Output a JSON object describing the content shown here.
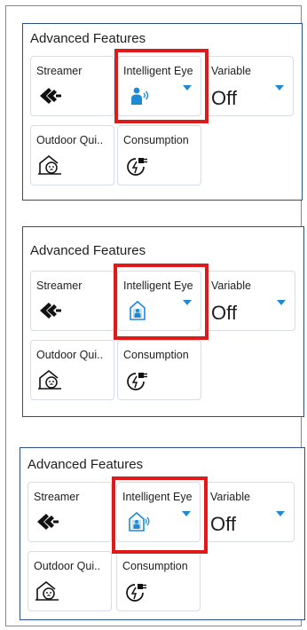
{
  "panels": [
    {
      "title": "Advanced Features",
      "tiles": [
        {
          "label": "Streamer",
          "icon": "streamer-icon"
        },
        {
          "label": "Intelligent Eye",
          "icon": "intelligent-eye-person-icon"
        },
        {
          "label": "Variable",
          "value": "Off"
        },
        {
          "label": "Outdoor Qui..",
          "icon": "outdoor-quiet-icon"
        },
        {
          "label": "Consumption",
          "icon": "consumption-plug-icon"
        }
      ]
    },
    {
      "title": "Advanced Features",
      "tiles": [
        {
          "label": "Streamer",
          "icon": "streamer-icon"
        },
        {
          "label": "Intelligent Eye",
          "icon": "intelligent-eye-absent-icon"
        },
        {
          "label": "Variable",
          "value": "Off"
        },
        {
          "label": "Outdoor Qui..",
          "icon": "outdoor-quiet-icon"
        },
        {
          "label": "Consumption",
          "icon": "consumption-plug-icon"
        }
      ]
    },
    {
      "title": "Advanced Features",
      "tiles": [
        {
          "label": "Streamer",
          "icon": "streamer-icon"
        },
        {
          "label": "Intelligent Eye",
          "icon": "intelligent-eye-present-icon"
        },
        {
          "label": "Variable",
          "value": "Off"
        },
        {
          "label": "Outdoor Qui..",
          "icon": "outdoor-quiet-icon"
        },
        {
          "label": "Consumption",
          "icon": "consumption-plug-icon"
        }
      ]
    }
  ],
  "colors": {
    "accent": "#1e8ad6",
    "highlight": "#e01919",
    "border": "#2c4f8e"
  }
}
